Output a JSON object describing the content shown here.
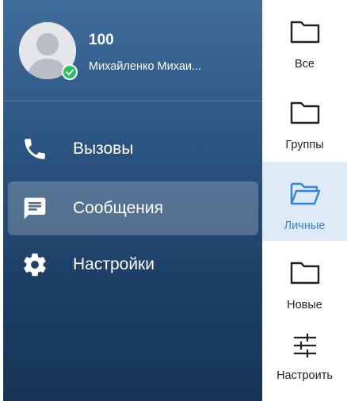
{
  "profile": {
    "number": "100",
    "name": "Михайленко Михаи...",
    "status_color": "#2bbf63"
  },
  "menu": [
    {
      "label": "Вызовы",
      "icon": "phone-icon",
      "active": false
    },
    {
      "label": "Сообщения",
      "icon": "message-icon",
      "active": true
    },
    {
      "label": "Настройки",
      "icon": "gear-icon",
      "active": false
    }
  ],
  "folders": [
    {
      "label": "Все",
      "icon": "folder-icon",
      "active": false
    },
    {
      "label": "Группы",
      "icon": "folder-icon",
      "active": false
    },
    {
      "label": "Личные",
      "icon": "folder-open-icon",
      "active": true
    },
    {
      "label": "Новые",
      "icon": "folder-icon",
      "active": false
    },
    {
      "label": "Настроить",
      "icon": "sliders-icon",
      "active": false
    }
  ],
  "colors": {
    "drawer_top": "#3f6d9c",
    "drawer_bottom": "#163457",
    "accent": "#3384d6",
    "active_folder_bg": "#deebf7"
  }
}
